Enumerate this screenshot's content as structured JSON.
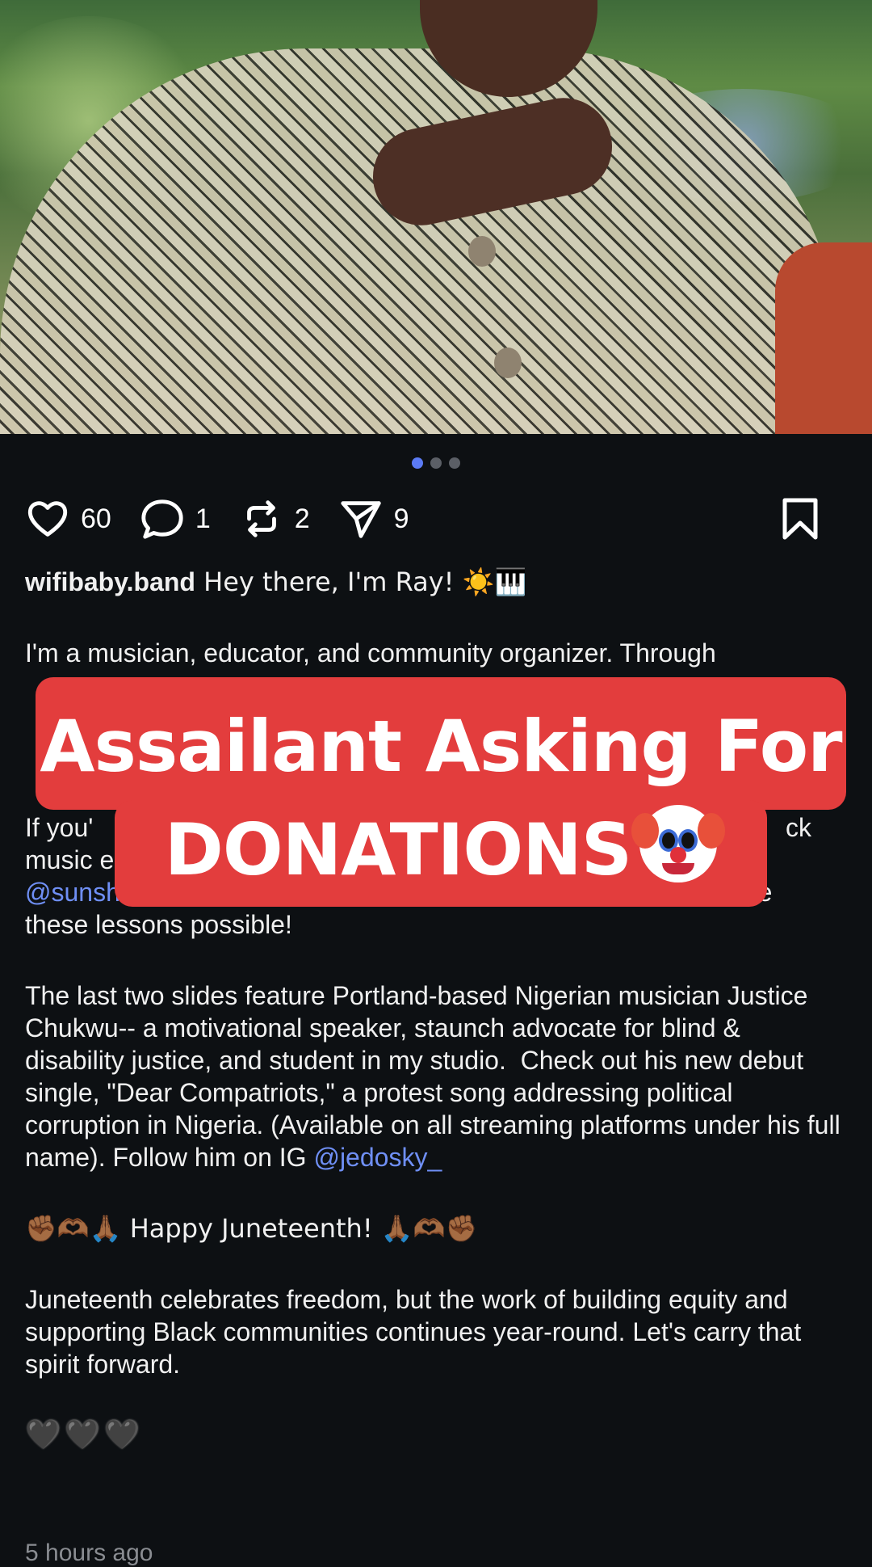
{
  "post": {
    "image_dots": 3,
    "actions": {
      "likes": "60",
      "comments": "1",
      "reposts": "2",
      "shares": "9"
    },
    "caption": {
      "username": "wifibaby.band",
      "intro": " Hey there, I'm Ray! ☀️🎹",
      "para1": "I'm a musician, educator, and community organizer. Through",
      "para2_start": "If you'",
      "para2_end": "ck",
      "para2_line2": "music e",
      "venmo_handle": "@sunshine_ray_studio",
      "venmo_text": " on Venmo. Every contribution helps make these lessons possible!",
      "para3": "The last two slides feature Portland-based Nigerian musician Justice Chukwu-- a motivational speaker, staunch advocate for blind & disability justice, and student in my studio.  Check out his new debut single, \"Dear Compatriots,\" a protest song addressing political corruption in Nigeria. (Available on all streaming platforms under his full name). Follow him on IG ",
      "ig_handle": "@jedosky_",
      "juneteenth": "✊🏾🫶🏾🙏🏾 Happy Juneteenth! 🙏🏾🫶🏾✊🏾",
      "para4": "Juneteenth celebrates freedom, but the work of building equity and supporting Black communities continues year-round. Let's carry that spirit forward.",
      "hearts": "🖤🖤🖤",
      "timestamp": "5 hours ago"
    }
  },
  "overlay": {
    "line1": "Assailant Asking For",
    "line2": "DONATIONS",
    "emoji_icon": "clown-face-icon",
    "banner_color": "#e33d3d"
  }
}
